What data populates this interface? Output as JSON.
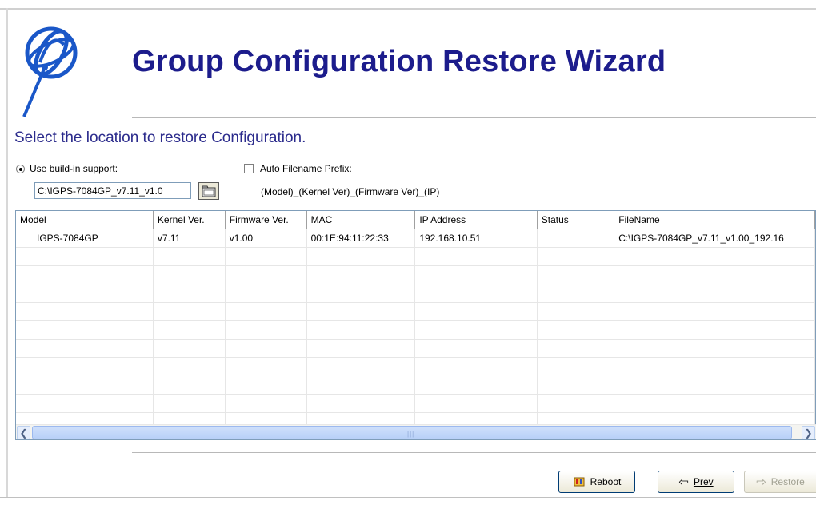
{
  "header": {
    "title": "Group Configuration Restore Wizard",
    "subtitle": "Select the location to restore Configuration.",
    "logo_icon": "satellite-logo-icon"
  },
  "options": {
    "use_builtin_label": "Use build-in support:",
    "use_builtin_selected": true,
    "path_value": "C:\\IGPS-7084GP_v7.11_v1.0",
    "browse_icon": "folder-browse-icon",
    "auto_prefix_label": "Auto Filename Prefix:",
    "auto_prefix_checked": false,
    "prefix_format": "(Model)_(Kernel Ver)_(Firmware Ver)_(IP)"
  },
  "table": {
    "columns": [
      "Model",
      "Kernel Ver.",
      "Firmware Ver.",
      "MAC",
      "IP Address",
      "Status",
      "FileName"
    ],
    "rows": [
      [
        "IGPS-7084GP",
        "v7.11",
        "v1.00",
        "00:1E:94:11:22:33",
        "192.168.10.51",
        "",
        "C:\\IGPS-7084GP_v7.11_v1.00_192.16"
      ]
    ]
  },
  "buttons": {
    "reboot": "Reboot",
    "prev": "Prev",
    "restore": "Restore"
  },
  "colors": {
    "title": "#1c1c8c",
    "subtitle": "#2b2b8c",
    "scrollbar": "#b8d0f8"
  }
}
